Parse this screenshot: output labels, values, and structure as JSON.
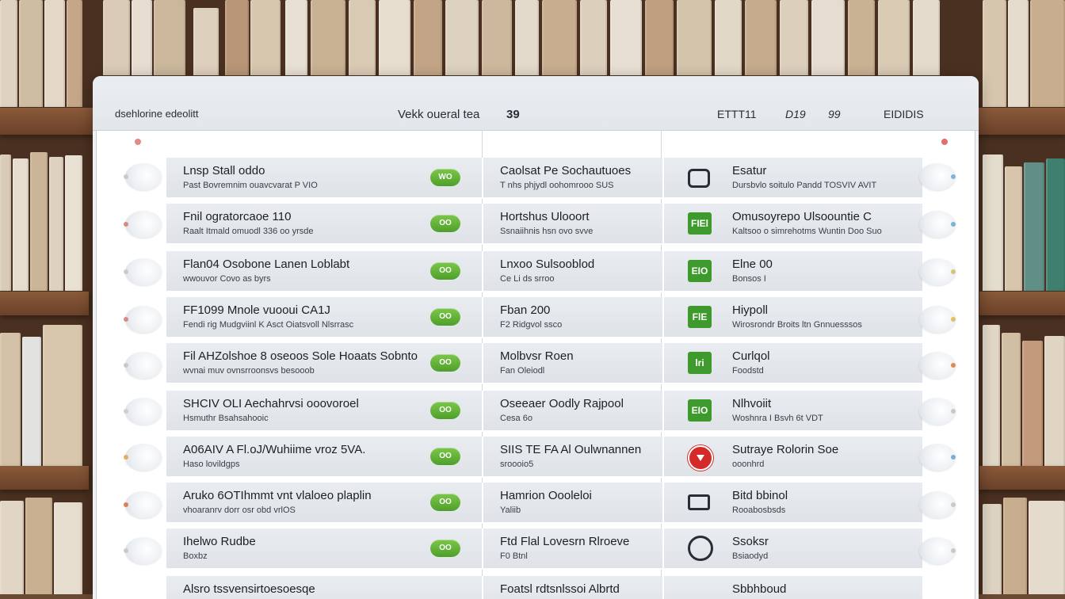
{
  "window": {
    "title_left": "dsehlorine edeolitt",
    "title_center": "Vekk oueral tea",
    "title_center_num": "39",
    "title_right_1": "ETTT11",
    "title_right_2": "D19",
    "title_right_3": "99",
    "title_right_4": "EIDIDIS"
  },
  "rows": [
    {
      "c1_title": "Lnsp Stall oddo",
      "c1_sub": "Past Bovremnim ouavcvarat P VIO",
      "badge": "WO",
      "c2_title": "Caolsat Pe Sochautuoes",
      "c2_sub": "T nhs phjydl oohomrooo SUS",
      "icon": "outline",
      "c3_title": "Esatur",
      "c3_sub": "Dursbvlo soitulo Pandd TOSVIV AVIT"
    },
    {
      "c1_title": "Fnil ogratorcaoe 110",
      "c1_sub": "Raalt Itmald omuodl 336 oo yrsde",
      "badge": "OO",
      "c2_title": "Hortshus Ulooort",
      "c2_sub": "Ssnaiihnis hsn ovo svve",
      "icon": "green",
      "icon_text": "FIEl",
      "c3_title": "Omusoyrepo Ulsoountie C",
      "c3_sub": "Kaltsoo o simrehotms Wuntin Doo Suo",
      "c3_sub_extra": ""
    },
    {
      "c1_title": "Flan04 Osobone Lanen Loblabt",
      "c1_sub": "wwouvor Covo as byrs",
      "badge": "OO",
      "c2_title": "Lnxoo Sulsooblod",
      "c2_sub": "Ce Li ds srroo",
      "icon": "green",
      "icon_text": "EIO",
      "c3_title": "Elne 00",
      "c3_sub": "Bonsos I"
    },
    {
      "c1_title": "FF1099 Mnole vuooui CA1J",
      "c1_sub": "Fendi rig Mudgviinl K Asct Oiatsvoll Nlsrrasc",
      "badge": "OO",
      "c2_title": "Fban 200",
      "c2_sub": "F2 Ridgvol ssco",
      "icon": "green",
      "icon_text": "FlE",
      "c3_title": "Hiypoll",
      "c3_sub": "Wirosrondr Broits ltn Gnnuesssos"
    },
    {
      "c1_title": "Fil AHZolshoe 8 oseoos Sole Hoaats Sobnto",
      "c1_sub": "wvnai muv ovnsrroonsvs besooob",
      "badge": "OO",
      "c2_title": "Molbvsr Roen",
      "c2_sub": "Fan Oleiodl",
      "icon": "green",
      "icon_text": "lri",
      "c3_title": "Curlqol",
      "c3_sub": "Foodstd"
    },
    {
      "c1_title": "SHCIV OLI Aechahrvsi ooovoroel",
      "c1_sub": "Hsmuthr Bsahsahooic",
      "badge": "OO",
      "c2_title": "Oseeaer Oodly Rajpool",
      "c2_sub": "Cesa 6o",
      "icon": "green",
      "icon_text": "EIO",
      "c3_title": "Nlhvoiit",
      "c3_sub": "Woshnra I Bsvh 6t VDT"
    },
    {
      "c1_title": "A06AIV A Fl.oJ/Wuhiime vroz 5VA.",
      "c1_sub": "Haso lovildgps",
      "badge": "OO",
      "c2_title": "SIIS TE FA Al Oulwnannen",
      "c2_sub": "sroooio5",
      "icon": "red",
      "c3_title": "Sutraye Rolorin Soe",
      "c3_sub": "ooonhrd"
    },
    {
      "c1_title": "Aruko 6OTIhmmt vnt vlaloeo plaplin",
      "c1_sub": "vhoaranrv dorr osr obd vrlOS",
      "badge": "OO",
      "c2_title": "Hamrion Oooleloi",
      "c2_sub": "Yaliib",
      "icon": "screen",
      "c3_title": "Bitd bbinol",
      "c3_sub": "Rooabosbsds"
    },
    {
      "c1_title": "Ihelwo Rudbe",
      "c1_sub": "Boxbz",
      "badge": "OO",
      "c2_title": "Ftd Flal Lovesrn Rlroeve",
      "c2_sub": "F0 Btnl",
      "icon": "owl",
      "c3_title": "Ssoksr",
      "c3_sub": "Bsiaodyd"
    }
  ],
  "partial_row": {
    "c1_title": "Alsro tssvensirtoesoesqe",
    "c2_title": "Foatsl rdtsnlssoi Albrtd",
    "c3_title": "Sbbhboud"
  },
  "colors": {
    "badge_green": "#5aae33",
    "icon_green": "#3f9a2e",
    "icon_red": "#d42a2a",
    "window_bg": "#eef0f3"
  }
}
